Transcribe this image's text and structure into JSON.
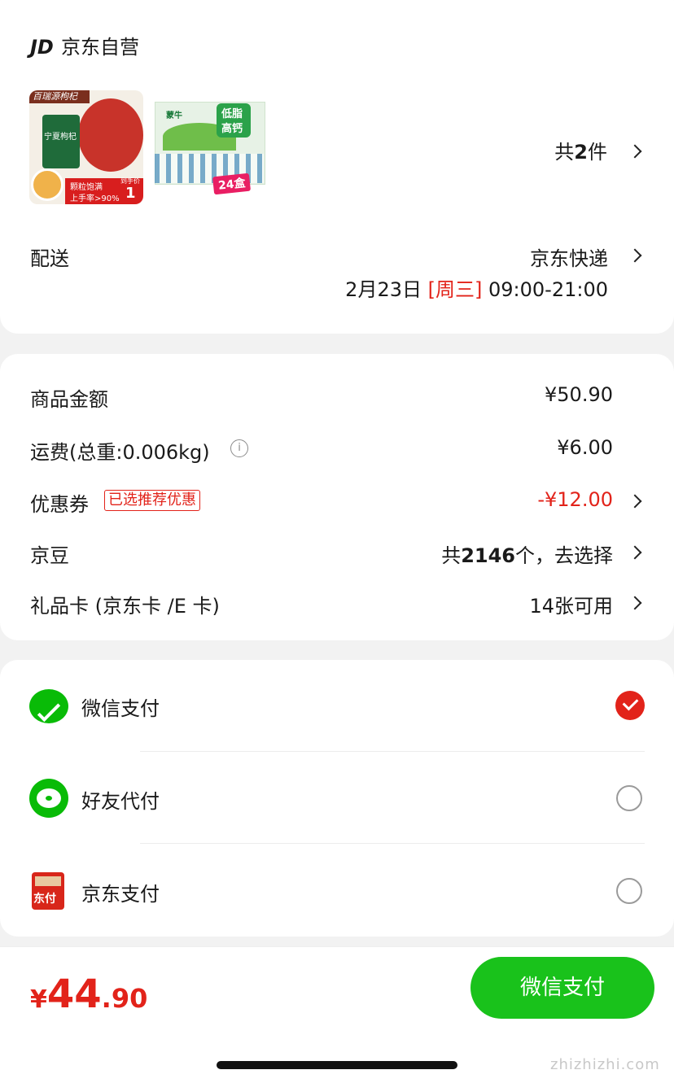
{
  "shop": {
    "logo": "JD",
    "name": "京东自营"
  },
  "products": {
    "item1": {
      "banner": "百瑞源枸杞",
      "pack": "宁夏枸杞",
      "tag1": "颗粒饱满",
      "tag2": "上手率>90%",
      "price_tag": "到手价",
      "price_val": "1"
    },
    "item2": {
      "brand": "蒙牛",
      "badge1": "低脂",
      "badge2": "高钙",
      "count": "24盒"
    },
    "count_prefix": "共",
    "count_value": "2",
    "count_suffix": "件"
  },
  "delivery": {
    "label": "配送",
    "carrier": "京东快递",
    "date": "2月23日",
    "weekday": "[周三]",
    "time": "09:00-21:00"
  },
  "summary": {
    "goods_label": "商品金额",
    "goods_value": "¥50.90",
    "shipping_label": "运费(总重:0.006kg)",
    "shipping_value": "¥6.00",
    "coupon_label": "优惠券",
    "coupon_badge": "已选推荐优惠",
    "coupon_value": "-¥12.00",
    "beans_label": "京豆",
    "beans_prefix": "共",
    "beans_count": "2146",
    "beans_suffix": "个，去选择",
    "giftcard_label": "礼品卡 (京东卡 /E 卡)",
    "giftcard_value": "14张可用"
  },
  "payment": {
    "methods": [
      {
        "label": "微信支付",
        "icon": "wechat-icon",
        "selected": true
      },
      {
        "label": "好友代付",
        "icon": "friend-pay-icon",
        "selected": false
      },
      {
        "label": "京东支付",
        "icon": "jd-pay-icon",
        "icon_text": "东付",
        "selected": false
      }
    ]
  },
  "footer": {
    "currency": "¥",
    "amount_int": "44",
    "amount_dec": ".90",
    "pay_button": "微信支付"
  },
  "watermark": "zhizhizhi.com",
  "colors": {
    "accent": "#e2231a",
    "wechat_green": "#09bb07",
    "pay_button": "#19c21b"
  }
}
